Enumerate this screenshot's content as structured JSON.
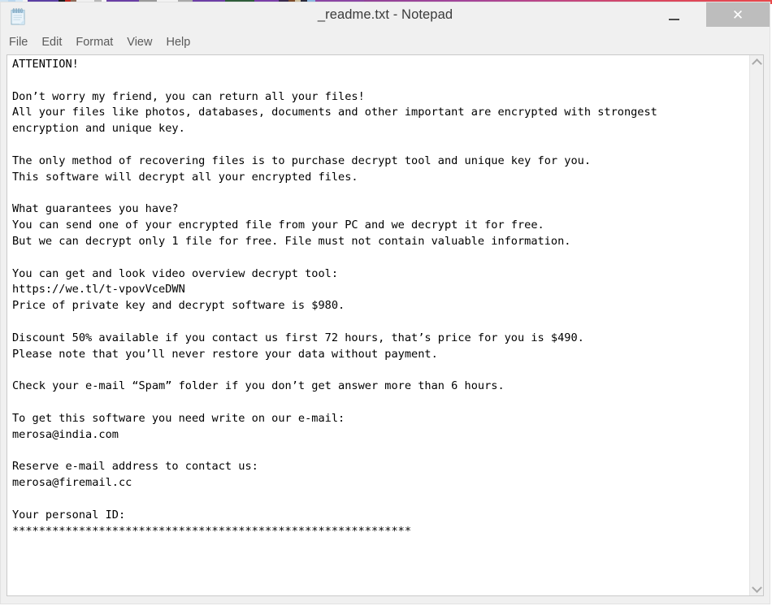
{
  "desktop": {
    "gradient_start": "#5d4a9e",
    "gradient_end": "#e8484a",
    "taskbar_thumbnails": [
      {
        "color": "#cfe3f2",
        "width": 10
      },
      {
        "color": "#b9d7ee",
        "width": 9
      },
      {
        "color": "#d5e8f6",
        "width": 9
      },
      {
        "color": "#f3f3f3",
        "width": 6
      },
      {
        "color": "#5b3fa3",
        "width": 38
      },
      {
        "color": "#1d1d1d",
        "width": 8
      },
      {
        "color": "#c02a22",
        "width": 7
      },
      {
        "color": "#8e6b58",
        "width": 7
      },
      {
        "color": "#f0f0f0",
        "width": 22
      },
      {
        "color": "#b8b8b8",
        "width": 9
      },
      {
        "color": "#f7f7f7",
        "width": 6
      },
      {
        "color": "#6a3fa5",
        "width": 40
      },
      {
        "color": "#9a9a9a",
        "width": 22
      },
      {
        "color": "#f2f2f2",
        "width": 26
      },
      {
        "color": "#a9a9a9",
        "width": 18
      },
      {
        "color": "#6d3fa6",
        "width": 40
      },
      {
        "color": "#2f5d3a",
        "width": 36
      },
      {
        "color": "#7a3fa8",
        "width": 30
      },
      {
        "color": "#3a2b4e",
        "width": 12
      },
      {
        "color": "#7d4c2a",
        "width": 8
      },
      {
        "color": "#d0c2a0",
        "width": 7
      },
      {
        "color": "#2b2b3b",
        "width": 8
      },
      {
        "color": "#8bb6e0",
        "width": 10
      },
      {
        "color": "#8b46a4",
        "width": 60
      }
    ]
  },
  "window": {
    "title": "_readme.txt - Notepad",
    "icon": "notepad-icon",
    "controls": {
      "minimize_label": "–",
      "maximize_label": "□",
      "close_label": "✕",
      "close_highlighted": true
    }
  },
  "menubar": {
    "items": [
      {
        "label": "File"
      },
      {
        "label": "Edit"
      },
      {
        "label": "Format"
      },
      {
        "label": "View"
      },
      {
        "label": "Help"
      }
    ]
  },
  "editor": {
    "word_wrap": false,
    "scrollbar": {
      "up_arrow": "chevron-up-icon",
      "down_arrow": "chevron-down-icon",
      "visible": true
    },
    "content": "ATTENTION!\n\nDon’t worry my friend, you can return all your files!\nAll your files like photos, databases, documents and other important are encrypted with strongest\nencryption and unique key.\n\nThe only method of recovering files is to purchase decrypt tool and unique key for you.\nThis software will decrypt all your encrypted files.\n\nWhat guarantees you have?\nYou can send one of your encrypted file from your PC and we decrypt it for free.\nBut we can decrypt only 1 file for free. File must not contain valuable information.\n\nYou can get and look video overview decrypt tool:\nhttps://we.tl/t-vpovVceDWN\nPrice of private key and decrypt software is $980.\n\nDiscount 50% available if you contact us first 72 hours, that’s price for you is $490.\nPlease note that you’ll never restore your data without payment.\n\nCheck your e-mail “Spam” folder if you don’t get answer more than 6 hours.\n\nTo get this software you need write on our e-mail:\nmerosa@india.com\n\nReserve e-mail address to contact us:\nmerosa@firemail.cc\n\nYour personal ID:\n************************************************************",
    "details": {
      "heading": "ATTENTION!",
      "video_overview_url": "https://we.tl/t-vpovVceDWN",
      "price_full": "$980",
      "price_discount": "$490",
      "discount_percent": "50%",
      "discount_window_hours": "72 hours",
      "response_time_hours": "6 hours",
      "free_decrypt_file_count": "1 file",
      "primary_email": "merosa@india.com",
      "reserve_email": "merosa@firemail.cc",
      "personal_id_mask": "************************************************************"
    }
  }
}
